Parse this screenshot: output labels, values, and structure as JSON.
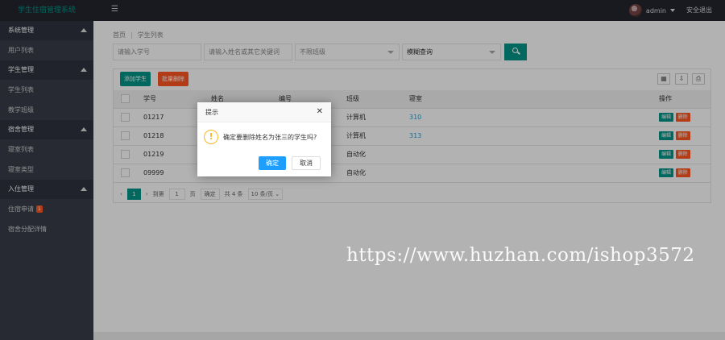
{
  "header": {
    "logo": "学生住宿管理系统",
    "menu_icon": "hamburger-icon",
    "username": "admin",
    "logout": "安全退出"
  },
  "sidebar": {
    "groups": [
      {
        "label": "系统管理",
        "items": [
          {
            "label": "用户列表"
          }
        ]
      },
      {
        "label": "学生管理",
        "items": [
          {
            "label": "学生列表"
          },
          {
            "label": "教学班级"
          }
        ]
      },
      {
        "label": "宿舍管理",
        "items": [
          {
            "label": "寝室列表"
          },
          {
            "label": "寝室类型"
          }
        ]
      },
      {
        "label": "入住管理",
        "items": [
          {
            "label": "住宿申请",
            "badge": "1"
          },
          {
            "label": "宿舍分配详情"
          }
        ]
      }
    ]
  },
  "breadcrumb": {
    "home": "首页",
    "sep": "|",
    "current": "学生列表"
  },
  "search": {
    "student_no_placeholder": "请输入学号",
    "keyword_placeholder": "请输入姓名或其它关键词",
    "class_select": "不限班级",
    "mode_select": "模糊查询"
  },
  "toolbar": {
    "add": "添加学生",
    "batch_delete": "批量删除",
    "icons": [
      "columns-icon",
      "export-icon",
      "print-icon"
    ]
  },
  "table": {
    "headers": [
      "学号",
      "姓名",
      "编号",
      "班级",
      "寝室",
      "操作"
    ],
    "rows": [
      {
        "no": "01217",
        "name": "",
        "code": "",
        "class": "计算机",
        "room": "310"
      },
      {
        "no": "01218",
        "name": "",
        "code": "",
        "class": "计算机",
        "room": "313"
      },
      {
        "no": "01219",
        "name": "",
        "code": "",
        "class": "自动化",
        "room": ""
      },
      {
        "no": "09999",
        "name": "",
        "code": "",
        "class": "自动化",
        "room": ""
      }
    ],
    "edit_label": "编辑",
    "delete_label": "删除"
  },
  "pagination": {
    "current_page": "1",
    "goto_label": "到第",
    "page_input": "1",
    "page_unit": "页",
    "confirm": "确定",
    "total": "共 4 条",
    "page_size": "10 条/页"
  },
  "dialog": {
    "title": "提示",
    "message": "确定要删除姓名为张三的学生吗?",
    "ok": "确定",
    "cancel": "取消"
  },
  "watermark": "https://www.huzhan.com/ishop3572",
  "colors": {
    "primary": "#009688",
    "danger": "#ff5722",
    "info": "#1e9fff",
    "warn": "#f7b824",
    "header": "#23262e",
    "sidebar": "#393d49"
  }
}
